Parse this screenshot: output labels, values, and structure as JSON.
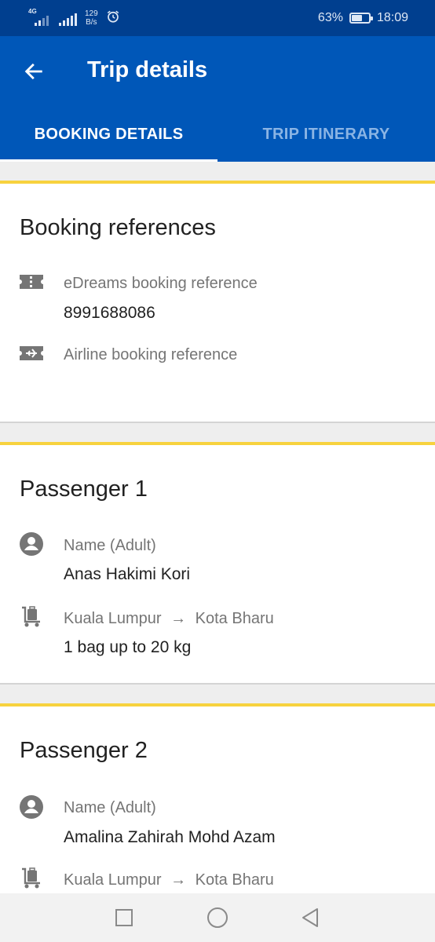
{
  "status_bar": {
    "network_label": "4G",
    "net_speed_value": "129",
    "net_speed_unit": "B/s",
    "battery": "63%",
    "battery_level": 0.63,
    "time": "18:09"
  },
  "app_bar": {
    "title": "Trip details",
    "back_icon": "arrow-left-icon"
  },
  "tabs": [
    {
      "label": "BOOKING DETAILS",
      "active": true
    },
    {
      "label": "TRIP ITINERARY",
      "active": false
    }
  ],
  "booking_references": {
    "title": "Booking references",
    "edreams_label": "eDreams booking reference",
    "edreams_value": "8991688086",
    "airline_label": "Airline booking reference"
  },
  "passengers": [
    {
      "title": "Passenger 1",
      "name_label": "Name (Adult)",
      "name": "Anas Hakimi Kori",
      "route_from": "Kuala Lumpur",
      "route_arrow": "→",
      "route_to": "Kota Bharu",
      "baggage": "1 bag up to 20 kg"
    },
    {
      "title": "Passenger 2",
      "name_label": "Name (Adult)",
      "name": "Amalina Zahirah Mohd Azam",
      "route_from": "Kuala Lumpur",
      "route_arrow": "→",
      "route_to": "Kota Bharu"
    }
  ],
  "colors": {
    "status_bar": "#003f8f",
    "app_bar": "#0057b8",
    "card_accent": "#f7d23e",
    "icon_gray": "#757575"
  }
}
